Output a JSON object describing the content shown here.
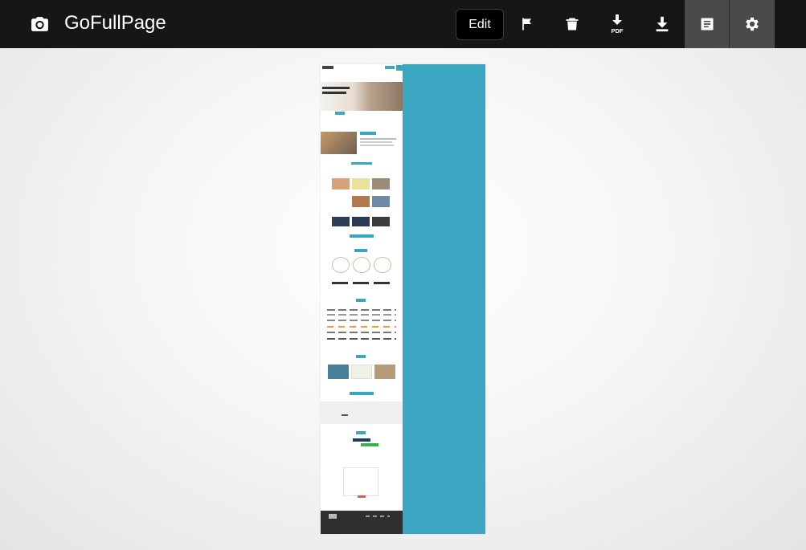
{
  "app": {
    "title": "GoFullPage"
  },
  "toolbar": {
    "edit_label": "Edit",
    "icons": [
      "camera-icon",
      "flag-icon",
      "trash-icon",
      "download-pdf-icon",
      "download-icon",
      "notes-icon",
      "gear-icon"
    ],
    "pdf_badge": "PDF",
    "active_icons": [
      "notes-icon",
      "gear-icon"
    ]
  },
  "colors": {
    "topbar": "#161616",
    "active_bg": "#4a4a4a",
    "side_panel": "#3aa6c2",
    "footer": "#2f2f2f",
    "accent_green": "#37b24d"
  },
  "preview": {
    "description_icons": [
      "page-thumbnail"
    ]
  }
}
